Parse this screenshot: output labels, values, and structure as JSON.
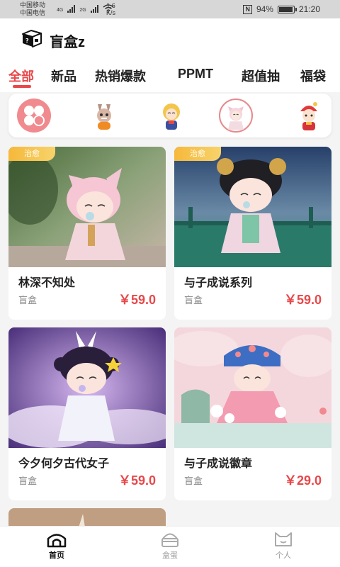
{
  "status_bar": {
    "carrier1": "中国移动",
    "carrier2": "中国电信",
    "net1": "4G",
    "net2": "2G",
    "speed_value": "1.6",
    "speed_unit": "K/s",
    "nfc": "N",
    "battery_text": "94%",
    "battery_level": 0.94,
    "time": "21:20"
  },
  "header": {
    "title": "盲盒z"
  },
  "tabs": [
    {
      "label": "全部",
      "active": true
    },
    {
      "label": "新品"
    },
    {
      "label": "热销爆款"
    },
    {
      "label": "PPMT"
    },
    {
      "label": "超值抽"
    },
    {
      "label": "福袋"
    }
  ],
  "categories": [
    {
      "name": "grid-all-icon"
    },
    {
      "name": "labubu-figure"
    },
    {
      "name": "blonde-doll-figure"
    },
    {
      "name": "cat-hat-doll-figure",
      "selected": true
    },
    {
      "name": "red-hat-doll-figure"
    }
  ],
  "products": [
    {
      "title": "林深不知处",
      "category": "盲盒",
      "price": "￥59.0",
      "badge": "治愈"
    },
    {
      "title": "与子成说系列",
      "category": "盲盒",
      "price": "￥59.0",
      "badge": "治愈"
    },
    {
      "title": "今夕何夕古代女子",
      "category": "盲盒",
      "price": "￥59.0"
    },
    {
      "title": "与子成说徽章",
      "category": "盲盒",
      "price": "￥29.0"
    }
  ],
  "bottom_nav": [
    {
      "label": "首页",
      "icon": "home-icon",
      "active": true
    },
    {
      "label": "盒蛋",
      "icon": "egg-box-icon"
    },
    {
      "label": "个人",
      "icon": "cat-face-icon"
    }
  ],
  "colors": {
    "accent": "#e8484a",
    "badge": "#f6b83a",
    "strip_selected": "#e7898c"
  }
}
